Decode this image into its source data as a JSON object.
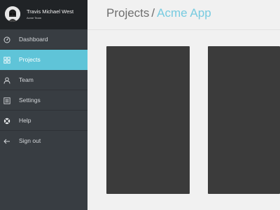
{
  "user": {
    "name": "Travis Michael West",
    "team": "Acme Team"
  },
  "nav": {
    "items": [
      {
        "label": "Dashboard",
        "icon": "dashboard-icon"
      },
      {
        "label": "Projects",
        "icon": "grid-icon",
        "active": true
      },
      {
        "label": "Team",
        "icon": "user-icon"
      },
      {
        "label": "Settings",
        "icon": "settings-list-icon"
      },
      {
        "label": "Help",
        "icon": "help-lifebuoy-icon"
      },
      {
        "label": "Sign out",
        "icon": "arrow-left-icon"
      }
    ]
  },
  "breadcrumb": {
    "section": "Projects",
    "separator": "/",
    "current": "Acme App"
  },
  "colors": {
    "sidebar_bg": "#383d42",
    "profile_bg": "#202326",
    "accent": "#5fc4d8",
    "breadcrumb_current": "#77cbe0",
    "card_bg": "#3b3b3b",
    "main_bg": "#f1f1f1"
  }
}
